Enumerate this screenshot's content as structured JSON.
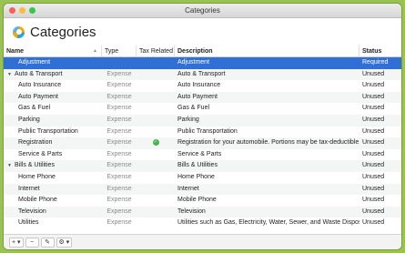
{
  "window": {
    "title": "Categories"
  },
  "header": {
    "title": "Categories"
  },
  "columns": {
    "name": "Name",
    "type": "Type",
    "tax": "Tax Related",
    "description": "Description",
    "status": "Status"
  },
  "rows": [
    {
      "name": "Adjustment",
      "type": "",
      "tax": false,
      "description": "Adjustment",
      "status": "Required",
      "level": 1,
      "group": false,
      "selected": true
    },
    {
      "name": "Auto & Transport",
      "type": "Expense",
      "tax": false,
      "description": "Auto & Transport",
      "status": "Unused",
      "level": 0,
      "group": true
    },
    {
      "name": "Auto Insurance",
      "type": "Expense",
      "tax": false,
      "description": "Auto Insurance",
      "status": "Unused",
      "level": 1,
      "group": false
    },
    {
      "name": "Auto Payment",
      "type": "Expense",
      "tax": false,
      "description": "Auto Payment",
      "status": "Unused",
      "level": 1,
      "group": false
    },
    {
      "name": "Gas & Fuel",
      "type": "Expense",
      "tax": false,
      "description": "Gas & Fuel",
      "status": "Unused",
      "level": 1,
      "group": false
    },
    {
      "name": "Parking",
      "type": "Expense",
      "tax": false,
      "description": "Parking",
      "status": "Unused",
      "level": 1,
      "group": false
    },
    {
      "name": "Public Transportation",
      "type": "Expense",
      "tax": false,
      "description": "Public Transportation",
      "status": "Unused",
      "level": 1,
      "group": false
    },
    {
      "name": "Registration",
      "type": "Expense",
      "tax": true,
      "description": "Registration for your automobile. Portions may be tax-deductible.",
      "status": "Unused",
      "level": 1,
      "group": false
    },
    {
      "name": "Service & Parts",
      "type": "Expense",
      "tax": false,
      "description": "Service & Parts",
      "status": "Unused",
      "level": 1,
      "group": false
    },
    {
      "name": "Bills & Utilities",
      "type": "Expense",
      "tax": false,
      "description": "Bills & Utilities",
      "status": "Unused",
      "level": 0,
      "group": true
    },
    {
      "name": "Home Phone",
      "type": "Expense",
      "tax": false,
      "description": "Home Phone",
      "status": "Unused",
      "level": 1,
      "group": false
    },
    {
      "name": "Internet",
      "type": "Expense",
      "tax": false,
      "description": "Internet",
      "status": "Unused",
      "level": 1,
      "group": false
    },
    {
      "name": "Mobile Phone",
      "type": "Expense",
      "tax": false,
      "description": "Mobile Phone",
      "status": "Unused",
      "level": 1,
      "group": false
    },
    {
      "name": "Television",
      "type": "Expense",
      "tax": false,
      "description": "Television",
      "status": "Unused",
      "level": 1,
      "group": false
    },
    {
      "name": "Utilities",
      "type": "Expense",
      "tax": false,
      "description": "Utilities such as Gas, Electricity, Water, Sewer, and Waste Disposal",
      "status": "Unused",
      "level": 1,
      "group": false
    }
  ],
  "icons": {
    "disclosure": "disclosure-triangle-icon",
    "tax": "checkmark-circle-icon"
  },
  "footer": {
    "add": "+ ▾",
    "remove": "−",
    "edit": "✎",
    "actions": "⚙ ▾"
  },
  "colors": {
    "selection": "#2f6fd6",
    "accent_green": "#46b54a",
    "background": "#9ac253"
  }
}
